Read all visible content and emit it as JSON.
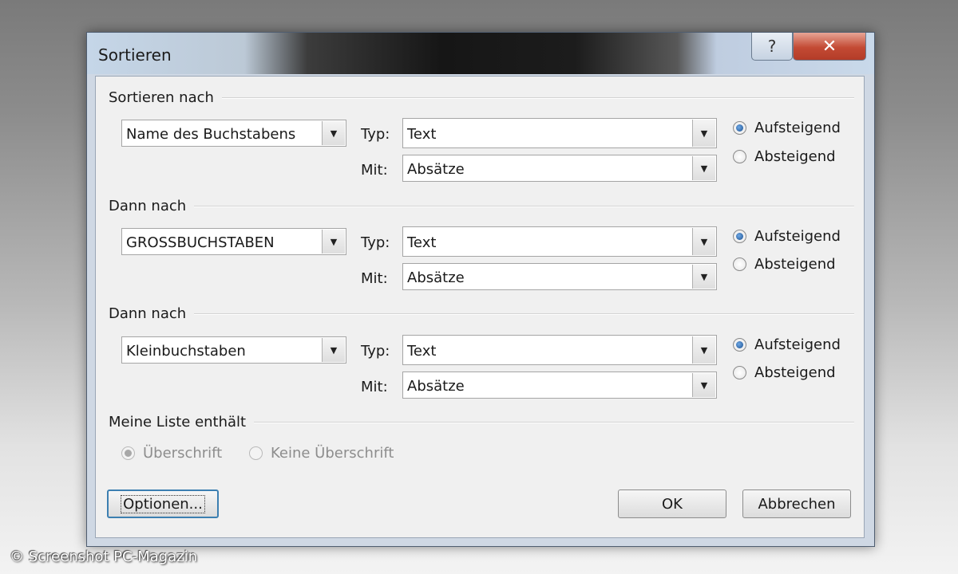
{
  "window": {
    "title": "Sortieren",
    "help_glyph": "?",
    "close_glyph": "✕"
  },
  "groups": [
    {
      "heading": "Sortieren nach",
      "key": "Name des Buchstabens",
      "type_label": "Typ:",
      "type_value": "Text",
      "with_label": "Mit:",
      "with_value": "Absätze",
      "ascending": "Aufsteigend",
      "descending": "Absteigend",
      "selected": "ascending"
    },
    {
      "heading": "Dann nach",
      "key": "GROSSBUCHSTABEN",
      "type_label": "Typ:",
      "type_value": "Text",
      "with_label": "Mit:",
      "with_value": "Absätze",
      "ascending": "Aufsteigend",
      "descending": "Absteigend",
      "selected": "ascending"
    },
    {
      "heading": "Dann nach",
      "key": "Kleinbuchstaben",
      "type_label": "Typ:",
      "type_value": "Text",
      "with_label": "Mit:",
      "with_value": "Absätze",
      "ascending": "Aufsteigend",
      "descending": "Absteigend",
      "selected": "ascending"
    }
  ],
  "list": {
    "heading": "Meine Liste enthält",
    "option_header": "Überschrift",
    "option_no_header": "Keine Überschrift",
    "selected": "header",
    "disabled": true
  },
  "buttons": {
    "options": "Optionen...",
    "ok": "OK",
    "cancel": "Abbrechen"
  },
  "dropdown_icon": "triangle-down",
  "watermark": "© Screenshot PC-Magazin"
}
